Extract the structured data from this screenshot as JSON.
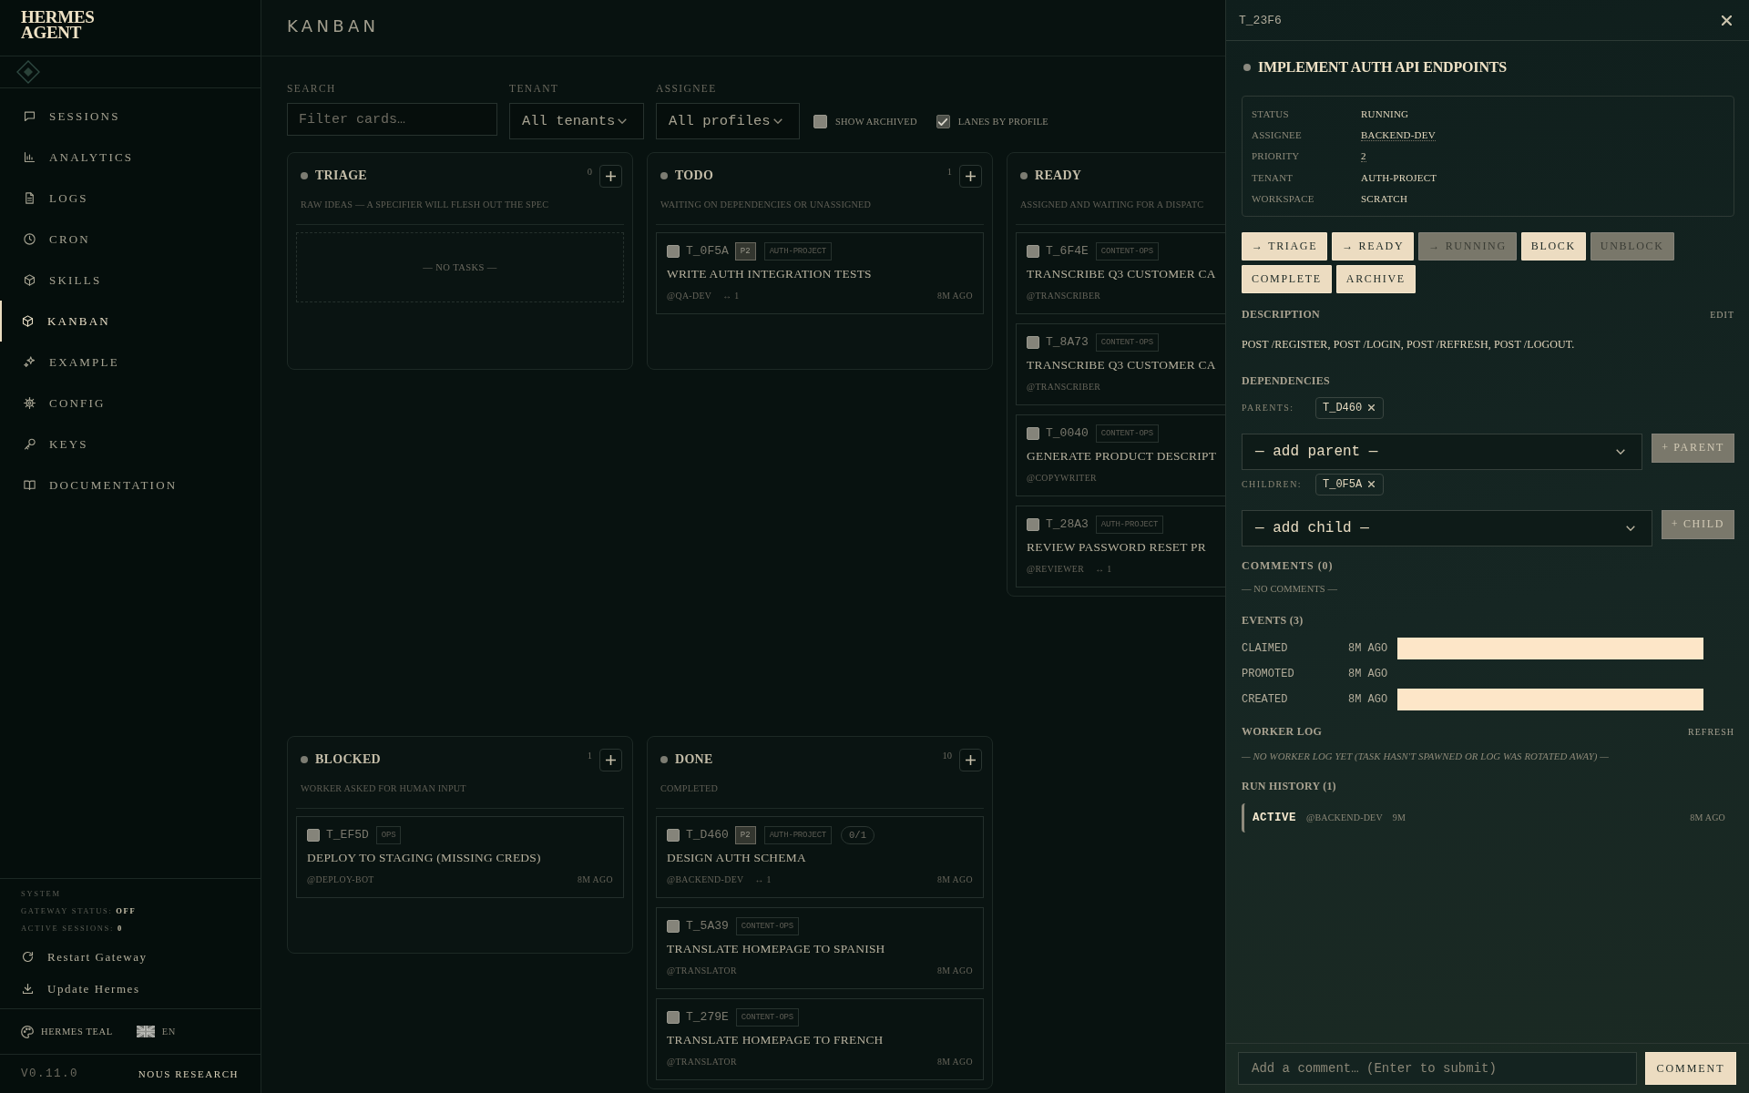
{
  "sidebar": {
    "logo_lines": [
      "HERMES",
      "AGENT"
    ],
    "nav": [
      {
        "label": "SESSIONS",
        "selected": false
      },
      {
        "label": "ANALYTICS",
        "selected": false
      },
      {
        "label": "LOGS",
        "selected": false
      },
      {
        "label": "CRON",
        "selected": false
      },
      {
        "label": "SKILLS",
        "selected": false
      },
      {
        "label": "KANBAN",
        "selected": true
      },
      {
        "label": "EXAMPLE",
        "selected": false
      },
      {
        "label": "CONFIG",
        "selected": false
      },
      {
        "label": "KEYS",
        "selected": false
      },
      {
        "label": "DOCUMENTATION",
        "selected": false
      }
    ],
    "system": {
      "heading": "SYSTEM",
      "lines": [
        "GATEWAY STATUS: **OFF**",
        "ACTIVE SESSIONS: **0**"
      ]
    },
    "actions": [
      "Restart Gateway",
      "Update Hermes"
    ],
    "theme": "HERMES TEAL",
    "language": "EN",
    "version": "V0.11.0",
    "brand": "NOUS RESEARCH"
  },
  "header": {
    "title": "KANBAN"
  },
  "filters": {
    "search": {
      "label": "SEARCH",
      "placeholder": "Filter cards…"
    },
    "tenant": {
      "label": "TENANT",
      "value": "All tenants"
    },
    "assignee": {
      "label": "ASSIGNEE",
      "value": "All profiles"
    },
    "toggles": [
      {
        "label": "SHOW ARCHIVED",
        "checked": false
      },
      {
        "label": "LANES BY PROFILE",
        "checked": true
      }
    ]
  },
  "lanes": [
    {
      "title": "TRIAGE",
      "count": "0",
      "description": "RAW IDEAS — A SPECIFIER WILL FLESH OUT THE SPEC",
      "empty_text": "— NO TASKS —"
    },
    {
      "title": "TODO",
      "count": "1",
      "description": "WAITING ON DEPENDENCIES OR UNASSIGNED",
      "cards": [
        {
          "id": "T_0F5A",
          "checked": false,
          "priority": "P2",
          "tags": [
            "AUTH-PROJECT"
          ],
          "title": "WRITE AUTH INTEGRATION TESTS",
          "assignee": "@QA-DEV",
          "links": "↔ 1",
          "age": "8M AGO"
        }
      ]
    },
    {
      "title": "READY",
      "description": "ASSIGNED AND WAITING FOR A DISPATC",
      "cards": [
        {
          "id": "T_6F4E",
          "checked": false,
          "tags": [
            "CONTENT-OPS"
          ],
          "title": "TRANSCRIBE Q3 CUSTOMER CA",
          "assignee": "@TRANSCRIBER"
        },
        {
          "id": "T_8A73",
          "checked": false,
          "tags": [
            "CONTENT-OPS"
          ],
          "title": "TRANSCRIBE Q3 CUSTOMER CA",
          "assignee": "@TRANSCRIBER"
        },
        {
          "id": "T_0040",
          "checked": false,
          "tags": [
            "CONTENT-OPS"
          ],
          "title": "GENERATE PRODUCT DESCRIPT",
          "assignee": "@COPYWRITER"
        },
        {
          "id": "T_28A3",
          "checked": false,
          "tags": [
            "AUTH-PROJECT"
          ],
          "title": "REVIEW PASSWORD RESET PR",
          "assignee": "@REVIEWER",
          "links": "↔ 1"
        }
      ]
    },
    {
      "title": "BLOCKED",
      "count": "1",
      "description": "WORKER ASKED FOR HUMAN INPUT",
      "cards": [
        {
          "id": "T_EF5D",
          "checked": false,
          "tags": [
            "OPS"
          ],
          "title": "DEPLOY TO STAGING (MISSING CREDS)",
          "assignee": "@DEPLOY-BOT",
          "age": "8M AGO"
        }
      ]
    },
    {
      "title": "DONE",
      "count": "10",
      "description": "COMPLETED",
      "cards": [
        {
          "id": "T_D460",
          "checked": false,
          "priority": "P2",
          "tags": [
            "AUTH-PROJECT"
          ],
          "progress": "0/1",
          "title": "DESIGN AUTH SCHEMA",
          "assignee": "@BACKEND-DEV",
          "links": "↔ 1",
          "age": "8M AGO"
        },
        {
          "id": "T_5A39",
          "checked": false,
          "tags": [
            "CONTENT-OPS"
          ],
          "title": "TRANSLATE HOMEPAGE TO SPANISH",
          "assignee": "@TRANSLATOR",
          "age": "8M AGO"
        },
        {
          "id": "T_279E",
          "checked": false,
          "tags": [
            "CONTENT-OPS"
          ],
          "title": "TRANSLATE HOMEPAGE TO FRENCH",
          "assignee": "@TRANSLATOR",
          "age": "8M AGO"
        }
      ]
    }
  ],
  "drawer": {
    "task_id": "T_23F6",
    "title": "IMPLEMENT AUTH API ENDPOINTS",
    "fields": [
      {
        "label": "STATUS",
        "value": "RUNNING",
        "editable": false
      },
      {
        "label": "ASSIGNEE",
        "value": "BACKEND-DEV",
        "editable": true
      },
      {
        "label": "PRIORITY",
        "value": "2",
        "editable": true
      },
      {
        "label": "TENANT",
        "value": "AUTH-PROJECT",
        "editable": false
      },
      {
        "label": "WORKSPACE",
        "value": "SCRATCH",
        "editable": false
      }
    ],
    "actions": [
      {
        "label": "→ TRIAGE",
        "disabled": false
      },
      {
        "label": "→ READY",
        "disabled": false
      },
      {
        "label": "→ RUNNING",
        "disabled": true
      },
      {
        "label": "BLOCK",
        "disabled": false
      },
      {
        "label": "UNBLOCK",
        "disabled": true
      },
      {
        "label": "COMPLETE",
        "disabled": false
      },
      {
        "label": "ARCHIVE",
        "disabled": false
      }
    ],
    "description": {
      "heading": "DESCRIPTION",
      "edit": "EDIT",
      "text": "POST /REGISTER, POST /LOGIN, POST /REFRESH, POST /LOGOUT."
    },
    "dependencies": {
      "heading": "DEPENDENCIES",
      "groups": [
        {
          "label": "PARENTS:",
          "chips": [
            "T_D460"
          ],
          "select": "— add parent —",
          "button": {
            "label": "+ PARENT",
            "disabled": true
          }
        },
        {
          "label": "CHILDREN:",
          "chips": [
            "T_0F5A"
          ],
          "select": "— add child —",
          "button": {
            "label": "+ CHILD",
            "disabled": true
          }
        }
      ]
    },
    "comments": {
      "heading": "COMMENTS (0)",
      "empty_text": "— NO COMMENTS —"
    },
    "events": {
      "heading": "EVENTS (3)",
      "items": [
        {
          "name": "CLAIMED",
          "age": "8M AGO",
          "payload_block": true
        },
        {
          "name": "PROMOTED",
          "age": "8M AGO",
          "payload_block": false
        },
        {
          "name": "CREATED",
          "age": "8M AGO",
          "payload_block": true
        }
      ]
    },
    "worker_log": {
      "heading": "WORKER LOG",
      "refresh": "REFRESH",
      "empty_text": "— NO WORKER LOG YET (TASK HASN'T SPAWNED OR LOG WAS ROTATED AWAY) —"
    },
    "run_history": {
      "heading": "RUN HISTORY (1)",
      "runs": [
        {
          "status": "ACTIVE",
          "assignee": "@BACKEND-DEV",
          "duration": "9M",
          "age": "8M AGO"
        }
      ]
    },
    "composer": {
      "placeholder": "Add a comment… (Enter to submit)",
      "button": "COMMENT"
    }
  }
}
